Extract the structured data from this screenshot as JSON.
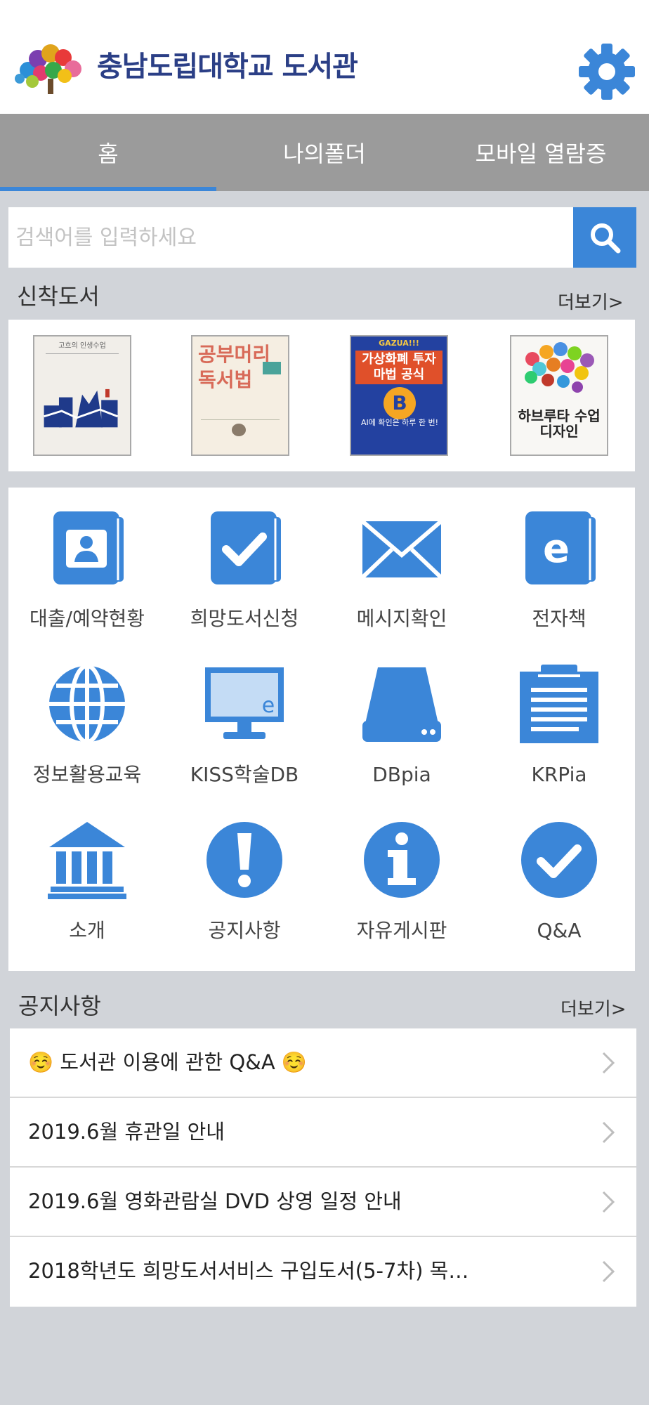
{
  "header": {
    "logo_text": "충남도립대학교 도서관",
    "brand_color": "#2b3f86",
    "settings_icon": "gear-icon"
  },
  "tabs": [
    {
      "label": "홈",
      "active": true
    },
    {
      "label": "나의폴더",
      "active": false
    },
    {
      "label": "모바일 열람증",
      "active": false
    }
  ],
  "search": {
    "placeholder": "검색어를 입력하세요",
    "value": "",
    "icon": "search-icon"
  },
  "new_books": {
    "title": "신착도서",
    "more_label": "더보기>",
    "books": [
      {
        "cover_title": "고흐의 인생수업"
      },
      {
        "cover_title": "공부머리 독서법"
      },
      {
        "cover_title": "가상화폐 투자 마법 공식",
        "cover_badge": "GAZUA!!!",
        "cover_note": "AI에 확인은 하루 한 번!"
      },
      {
        "cover_title": "하브루타 수업디자인"
      }
    ]
  },
  "menu": {
    "items": [
      {
        "label": "대출/예약현황",
        "icon": "user-book-icon"
      },
      {
        "label": "희망도서신청",
        "icon": "check-book-icon"
      },
      {
        "label": "메시지확인",
        "icon": "envelope-icon"
      },
      {
        "label": "전자책",
        "icon": "ebook-icon"
      },
      {
        "label": "정보활용교육",
        "icon": "globe-icon"
      },
      {
        "label": "KISS학술DB",
        "icon": "monitor-icon"
      },
      {
        "label": "DBpia",
        "icon": "hard-drive-icon"
      },
      {
        "label": "KRPia",
        "icon": "clipboard-icon"
      },
      {
        "label": "소개",
        "icon": "library-building-icon"
      },
      {
        "label": "공지사항",
        "icon": "exclamation-icon"
      },
      {
        "label": "자유게시판",
        "icon": "info-icon"
      },
      {
        "label": "Q&A",
        "icon": "check-circle-icon"
      }
    ]
  },
  "notices": {
    "title": "공지사항",
    "more_label": "더보기>",
    "items": [
      {
        "text": "☺️ 도서관 이용에 관한 Q&A ☺️"
      },
      {
        "text": "2019.6월 휴관일 안내"
      },
      {
        "text": "2019.6월 영화관람실 DVD 상영 일정 안내"
      },
      {
        "text": "2018학년도 희망도서서비스 구입도서(5-7차) 목…"
      }
    ]
  },
  "colors": {
    "accent": "#3b86d8",
    "tab_bar": "#9b9b9b",
    "background": "#d1d4d9"
  }
}
